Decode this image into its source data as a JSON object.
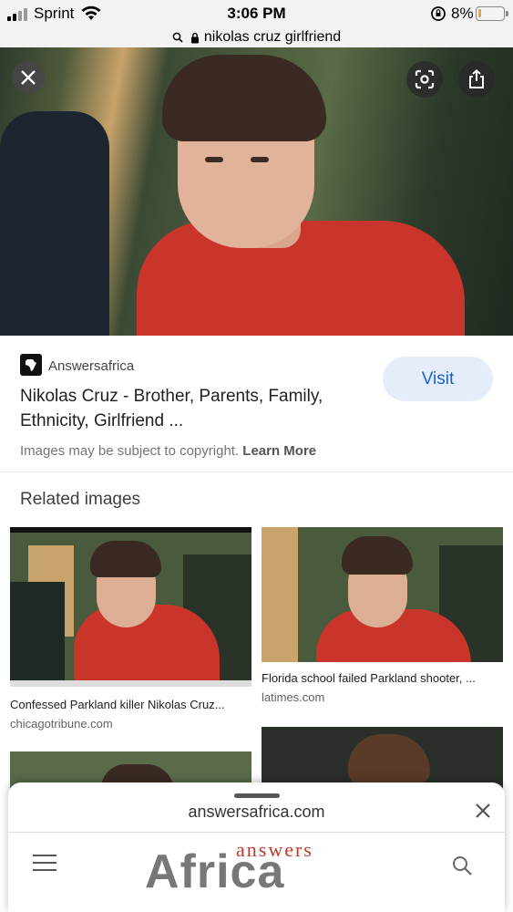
{
  "status_bar": {
    "carrier": "Sprint",
    "time": "3:06 PM",
    "battery_percent": "8%",
    "battery_level": 0.08
  },
  "url_bar": {
    "query": "nikolas cruz girlfriend"
  },
  "image_viewer": {
    "source": {
      "site_name": "Answersafrica",
      "title": "Nikolas Cruz - Brother, Parents, Family, Ethnicity, Girlfriend ...",
      "visit_label": "Visit",
      "copyright_text": "Images may be subject to copyright.",
      "learn_more_label": "Learn More"
    }
  },
  "related": {
    "heading": "Related images",
    "items": [
      {
        "caption": "Confessed Parkland killer Nikolas Cruz...",
        "domain": "chicagotribune.com"
      },
      {
        "caption": "Florida school failed Parkland shooter, ...",
        "domain": "latimes.com"
      }
    ]
  },
  "bottom_sheet": {
    "domain": "answersafrica.com",
    "logo_top": "answers",
    "logo_main": "Africa"
  },
  "colors": {
    "accent_blue": "#1a63d2",
    "visit_bg": "#e5edfb",
    "shirt_red": "#c9352b"
  }
}
